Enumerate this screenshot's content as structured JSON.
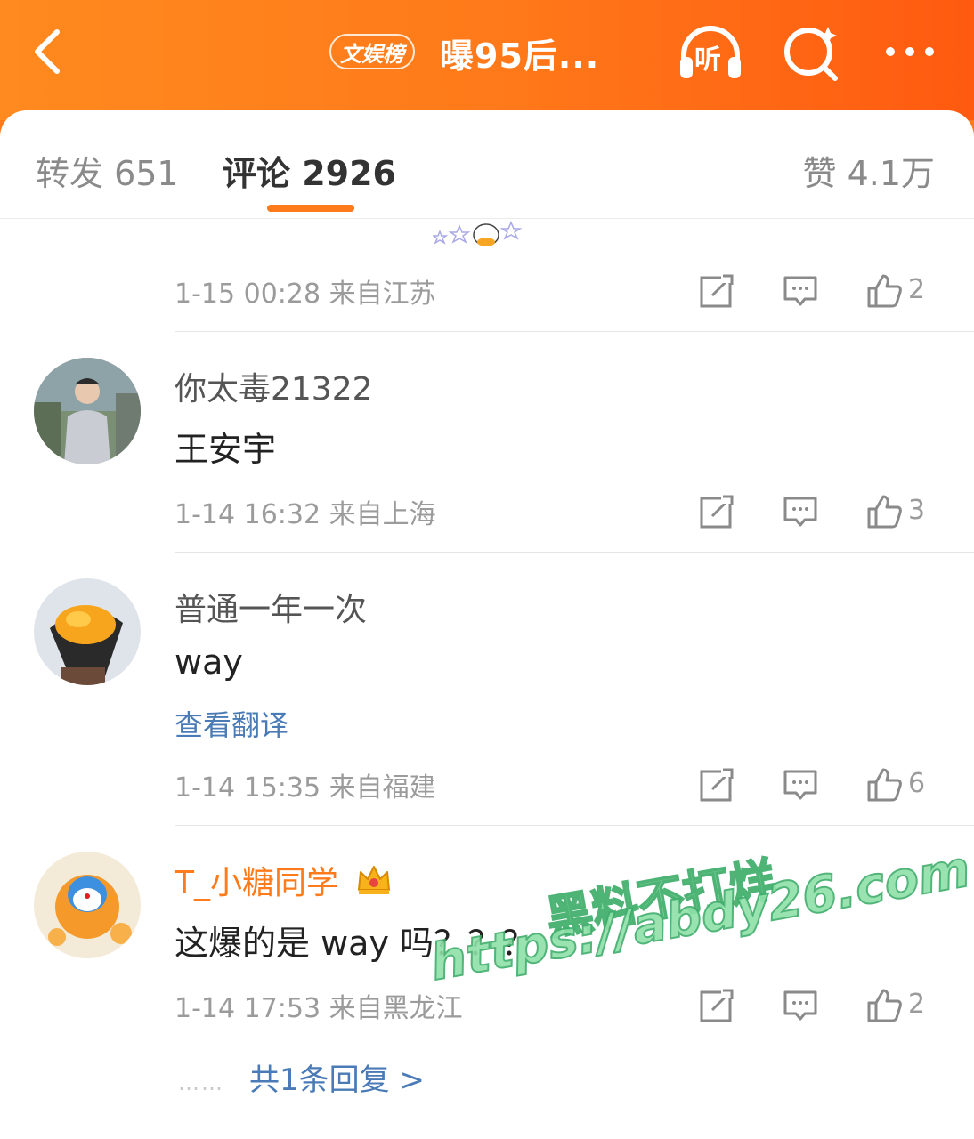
{
  "header": {
    "back_icon": "chevron-left-icon",
    "hot_tag": "文娱榜",
    "title": "曝95后...",
    "listen_label": "听",
    "search_icon": "search-icon",
    "more_icon": "more-dots-icon"
  },
  "tabs": {
    "repost": "转发 651",
    "comment": "评论 2926",
    "like": "赞 4.1万"
  },
  "comments": [
    {
      "time_location": "1-15 00:28  来自江苏",
      "like_count": "2"
    },
    {
      "username": "你太毒21322",
      "content": "王安宇",
      "time_location": "1-14 16:32  来自上海",
      "like_count": "3"
    },
    {
      "username": "普通一年一次",
      "content": "way",
      "translate": "查看翻译",
      "time_location": "1-14 15:35  来自福建",
      "like_count": "6"
    },
    {
      "username": "T_小糖同学",
      "content": "这爆的是 way 吗？？？",
      "time_location": "1-14 17:53  来自黑龙江",
      "like_count": "2",
      "reply_summary": "共1条回复 >"
    }
  ],
  "watermark": {
    "line1": "黑料不打烊",
    "line2": "https://abdy26.com"
  },
  "colors": {
    "brand_orange": "#ff7a1a",
    "link_blue": "#4a7bb7",
    "meta_gray": "#9b9b9b"
  }
}
